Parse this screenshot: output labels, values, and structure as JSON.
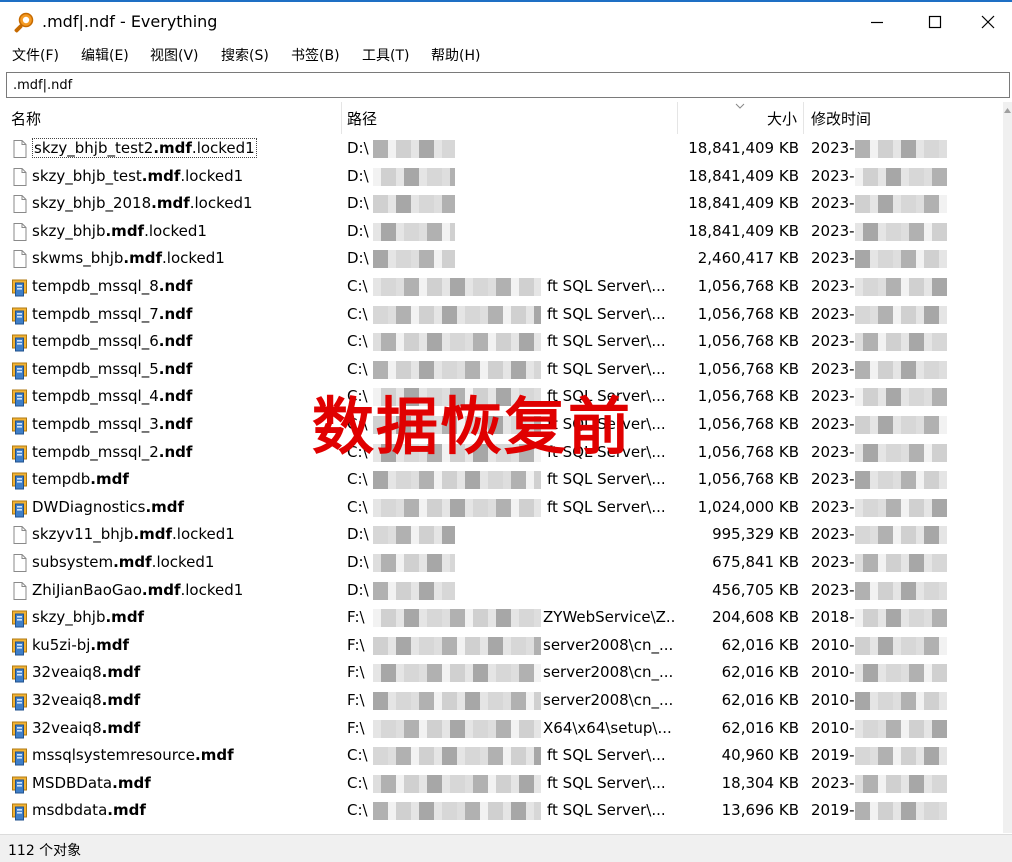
{
  "window": {
    "title": ".mdf|.ndf - Everything"
  },
  "menu": [
    {
      "label": "文件(F)"
    },
    {
      "label": "编辑(E)"
    },
    {
      "label": "视图(V)"
    },
    {
      "label": "搜索(S)"
    },
    {
      "label": "书签(B)"
    },
    {
      "label": "工具(T)"
    },
    {
      "label": "帮助(H)"
    }
  ],
  "search": {
    "value": ".mdf|.ndf"
  },
  "columns": {
    "name": "名称",
    "path": "路径",
    "size": "大小",
    "modified": "修改时间"
  },
  "rows": [
    {
      "pre": "skzy_bhjb_test2",
      "match": ".mdf",
      "post": ".locked1",
      "path": "D:\\",
      "path_tail": "",
      "size": "18,841,409 KB",
      "date": "2023-",
      "icon": "file"
    },
    {
      "pre": "skzy_bhjb_test",
      "match": ".mdf",
      "post": ".locked1",
      "path": "D:\\",
      "path_tail": "",
      "size": "18,841,409 KB",
      "date": "2023-",
      "icon": "file"
    },
    {
      "pre": "skzy_bhjb_2018",
      "match": ".mdf",
      "post": ".locked1",
      "path": "D:\\",
      "path_tail": "",
      "size": "18,841,409 KB",
      "date": "2023-",
      "icon": "file"
    },
    {
      "pre": "skzy_bhjb",
      "match": ".mdf",
      "post": ".locked1",
      "path": "D:\\",
      "path_tail": "",
      "size": "18,841,409 KB",
      "date": "2023-",
      "icon": "file"
    },
    {
      "pre": "skwms_bhjb",
      "match": ".mdf",
      "post": ".locked1",
      "path": "D:\\",
      "path_tail": "",
      "size": "2,460,417 KB",
      "date": "2023-",
      "icon": "file"
    },
    {
      "pre": "tempdb_mssql_8",
      "match": ".ndf",
      "post": "",
      "path": "C:\\",
      "path_tail": "ft SQL Server\\...",
      "size": "1,056,768 KB",
      "date": "2023-",
      "icon": "db"
    },
    {
      "pre": "tempdb_mssql_7",
      "match": ".ndf",
      "post": "",
      "path": "C:\\",
      "path_tail": "ft SQL Server\\...",
      "size": "1,056,768 KB",
      "date": "2023-",
      "icon": "db"
    },
    {
      "pre": "tempdb_mssql_6",
      "match": ".ndf",
      "post": "",
      "path": "C:\\",
      "path_tail": "ft SQL Server\\...",
      "size": "1,056,768 KB",
      "date": "2023-",
      "icon": "db"
    },
    {
      "pre": "tempdb_mssql_5",
      "match": ".ndf",
      "post": "",
      "path": "C:\\",
      "path_tail": "ft SQL Server\\...",
      "size": "1,056,768 KB",
      "date": "2023-",
      "icon": "db"
    },
    {
      "pre": "tempdb_mssql_4",
      "match": ".ndf",
      "post": "",
      "path": "C:\\",
      "path_tail": "ft SQL Server\\...",
      "size": "1,056,768 KB",
      "date": "2023-",
      "icon": "db"
    },
    {
      "pre": "tempdb_mssql_3",
      "match": ".ndf",
      "post": "",
      "path": "C:\\",
      "path_tail": "ft SQL Server\\...",
      "size": "1,056,768 KB",
      "date": "2023-",
      "icon": "db"
    },
    {
      "pre": "tempdb_mssql_2",
      "match": ".ndf",
      "post": "",
      "path": "C:\\",
      "path_tail": "ft SQL Server\\...",
      "size": "1,056,768 KB",
      "date": "2023-",
      "icon": "db"
    },
    {
      "pre": "tempdb",
      "match": ".mdf",
      "post": "",
      "path": "C:\\",
      "path_tail": "ft SQL Server\\...",
      "size": "1,056,768 KB",
      "date": "2023-",
      "icon": "db"
    },
    {
      "pre": "DWDiagnostics",
      "match": ".mdf",
      "post": "",
      "path": "C:\\",
      "path_tail": "ft SQL Server\\...",
      "size": "1,024,000 KB",
      "date": "2023-",
      "icon": "db"
    },
    {
      "pre": "skzyv11_bhjb",
      "match": ".mdf",
      "post": ".locked1",
      "path": "D:\\",
      "path_tail": "",
      "size": "995,329 KB",
      "date": "2023-",
      "icon": "file"
    },
    {
      "pre": "subsystem",
      "match": ".mdf",
      "post": ".locked1",
      "path": "D:\\",
      "path_tail": "",
      "size": "675,841 KB",
      "date": "2023-",
      "icon": "file"
    },
    {
      "pre": "ZhiJianBaoGao",
      "match": ".mdf",
      "post": ".locked1",
      "path": "D:\\",
      "path_tail": "",
      "size": "456,705 KB",
      "date": "2023-",
      "icon": "file"
    },
    {
      "pre": "skzy_bhjb",
      "match": ".mdf",
      "post": "",
      "path": "F:\\",
      "path_tail": "ZYWebService\\Z...",
      "size": "204,608 KB",
      "date": "2018-",
      "icon": "db"
    },
    {
      "pre": "ku5zi-bj",
      "match": ".mdf",
      "post": "",
      "path": "F:\\",
      "path_tail": "server2008\\cn_...",
      "size": "62,016 KB",
      "date": "2010-",
      "icon": "db"
    },
    {
      "pre": "32veaiq8",
      "match": ".mdf",
      "post": "",
      "path": "F:\\",
      "path_tail": "server2008\\cn_...",
      "size": "62,016 KB",
      "date": "2010-",
      "icon": "db"
    },
    {
      "pre": "32veaiq8",
      "match": ".mdf",
      "post": "",
      "path": "F:\\",
      "path_tail": "server2008\\cn_...",
      "size": "62,016 KB",
      "date": "2010-",
      "icon": "db"
    },
    {
      "pre": "32veaiq8",
      "match": ".mdf",
      "post": "",
      "path": "F:\\",
      "path_tail": "X64\\x64\\setup\\...",
      "size": "62,016 KB",
      "date": "2010-",
      "icon": "db"
    },
    {
      "pre": "mssqlsystemresource",
      "match": ".mdf",
      "post": "",
      "path": "C:\\",
      "path_tail": "ft SQL Server\\...",
      "size": "40,960 KB",
      "date": "2019-",
      "icon": "db"
    },
    {
      "pre": "MSDBData",
      "match": ".mdf",
      "post": "",
      "path": "C:\\",
      "path_tail": "ft SQL Server\\...",
      "size": "18,304 KB",
      "date": "2023-",
      "icon": "db"
    },
    {
      "pre": "msdbdata",
      "match": ".mdf",
      "post": "",
      "path": "C:\\",
      "path_tail": "ft SQL Server\\...",
      "size": "13,696 KB",
      "date": "2019-",
      "icon": "db"
    }
  ],
  "watermark": "数据恢复前",
  "status": {
    "count": "112 个对象"
  }
}
